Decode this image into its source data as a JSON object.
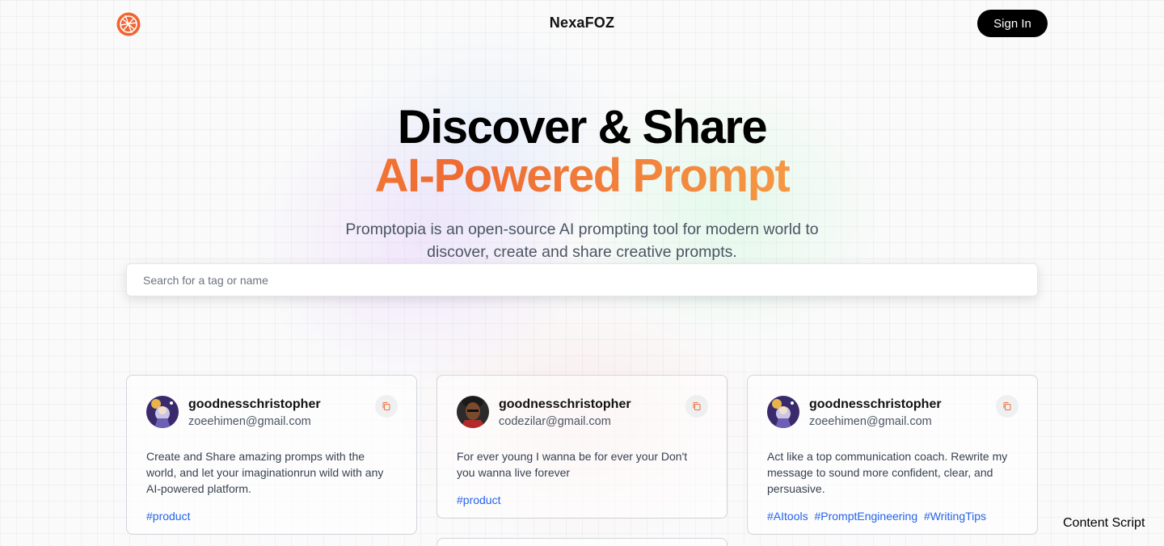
{
  "nav": {
    "brand": "NexaFOZ",
    "sign_in_label": "Sign In"
  },
  "hero": {
    "title_line1": "Discover & Share",
    "title_line2": "AI-Powered Prompt",
    "description": "Promptopia is an open-source AI prompting tool for modern world to discover, create and share creative prompts."
  },
  "search": {
    "placeholder": "Search for a tag or name",
    "value": ""
  },
  "cards": [
    {
      "username": "goodnesschristopher",
      "email": "zoeehimen@gmail.com",
      "prompt": "Create and Share amazing promps with the world, and let your imaginationrun wild with any AI-powered platform.",
      "tags": [
        "#product"
      ]
    },
    {
      "username": "goodnesschristopher",
      "email": "codezilar@gmail.com",
      "prompt": "For ever young I wanna be for ever your Don't you wanna live forever",
      "tags": [
        "#product"
      ]
    },
    {
      "username": "goodnesschristopher",
      "email": "zoeehimen@gmail.com",
      "prompt": "Act like a top communication coach. Rewrite my message to sound more confident, clear, and persuasive.",
      "tags": [
        "#AItools",
        "#PromptEngineering",
        "#WritingTips"
      ]
    }
  ],
  "overlay_label": "Content Script",
  "colors": {
    "accent_orange": "#ef6a32",
    "tag_blue": "#2563eb",
    "button_black": "#000000"
  }
}
